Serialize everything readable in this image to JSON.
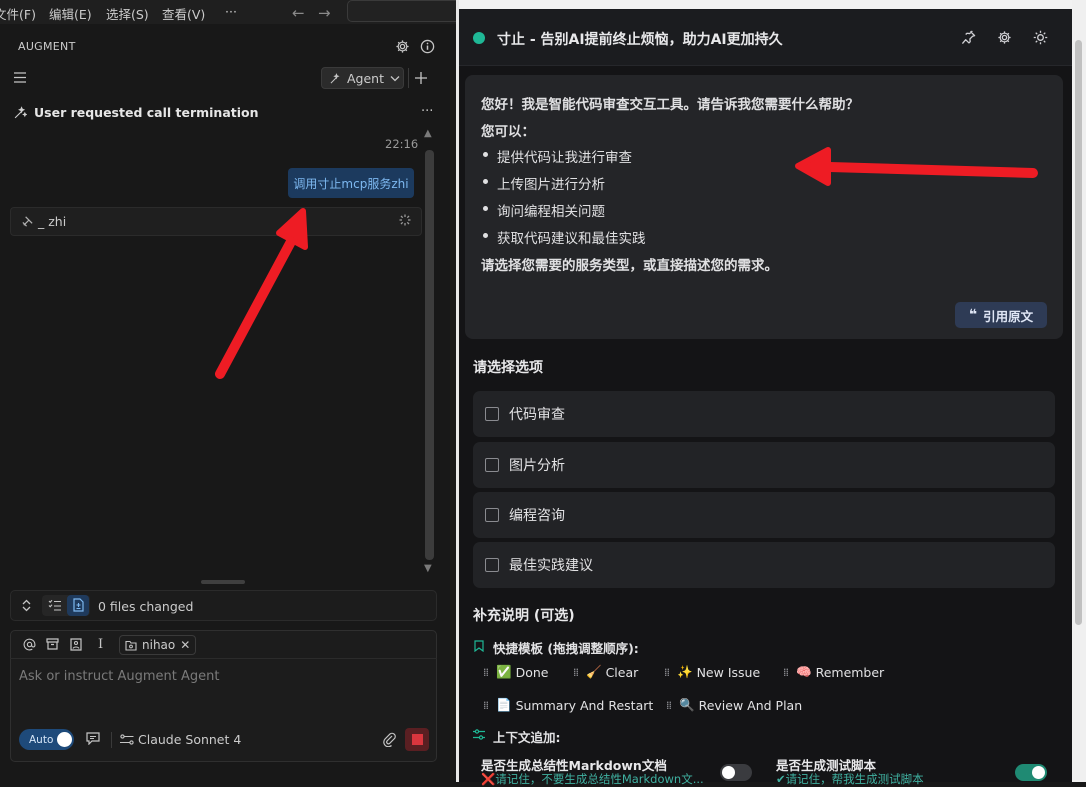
{
  "menubar": {
    "items": [
      "文件(F)",
      "编辑(E)",
      "选择(S)",
      "查看(V)"
    ],
    "more": "···"
  },
  "augment": {
    "panel_title": "AUGMENT",
    "agent_mode": "Agent",
    "thread_title": "User requested call termination",
    "timestamp": "22:16",
    "user_message": "调用寸止mcp服务zhi",
    "tool_call": "_ zhi",
    "files_changed": "0 files changed",
    "context_chip": "nihao",
    "input_placeholder": "Ask or instruct Augment Agent",
    "auto_label": "Auto",
    "model": "Claude Sonnet 4"
  },
  "app": {
    "title": "寸止 - 告别AI提前终止烦恼，助力AI更加持久",
    "status_color": "#1fb896",
    "message": {
      "greeting": "您好！我是智能代码审查交互工具。请告诉我您需要什么帮助？",
      "intro": "您可以：",
      "bullets": [
        "提供代码让我进行审查",
        "上传图片进行分析",
        "询问编程相关问题",
        "获取代码建议和最佳实践"
      ],
      "closing": "请选择您需要的服务类型，或直接描述您的需求。"
    },
    "quote_button": "引用原文",
    "options_title": "请选择选项",
    "options": [
      "代码审查",
      "图片分析",
      "编程咨询",
      "最佳实践建议"
    ],
    "supplement_title": "补充说明 (可选)",
    "templates_title": "快捷模板 (拖拽调整顺序):",
    "templates": [
      {
        "emoji": "✅",
        "label": "Done"
      },
      {
        "emoji": "🧹",
        "label": "Clear"
      },
      {
        "emoji": "✨",
        "label": "New Issue"
      },
      {
        "emoji": "🧠",
        "label": "Remember"
      },
      {
        "emoji": "📄",
        "label": "Summary And Restart"
      },
      {
        "emoji": "🔍",
        "label": "Review And Plan"
      }
    ],
    "context_title": "上下文追加:",
    "context_options": [
      {
        "label": "是否生成总结性Markdown文档",
        "hint": "❌请记住，不要生成总结性Markdown文...",
        "enabled": false
      },
      {
        "label": "是否生成测试脚本",
        "hint": "✔请记住，帮我生成测试脚本",
        "enabled": true
      }
    ]
  }
}
